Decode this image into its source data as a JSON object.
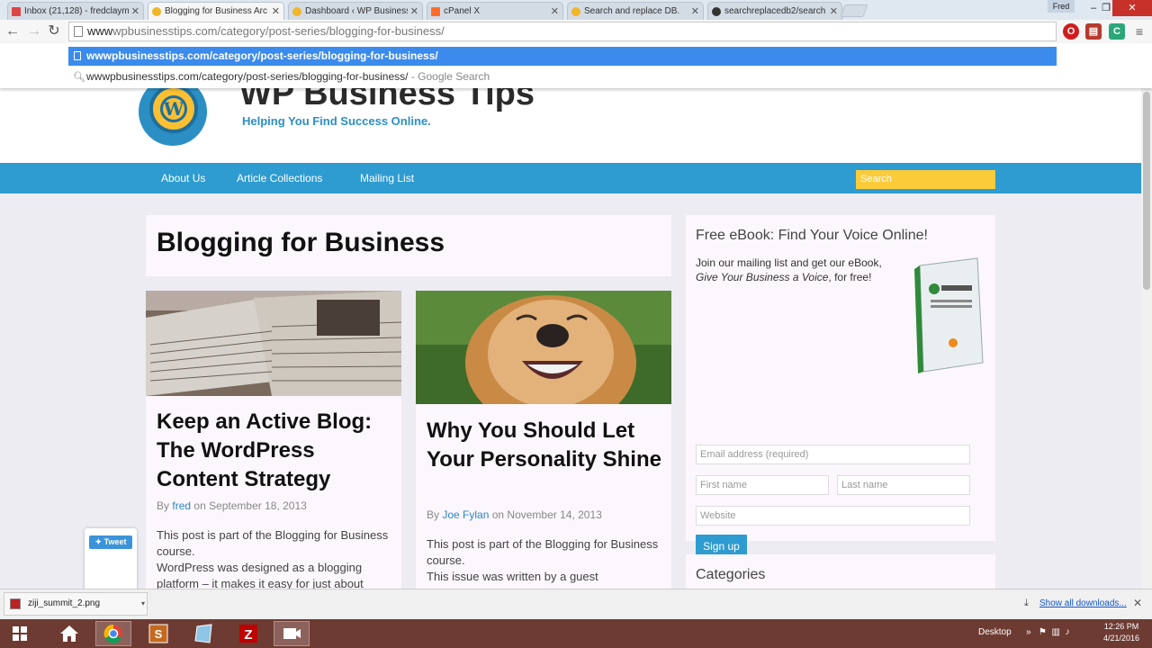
{
  "browser": {
    "tabs": [
      {
        "label": "Inbox (21,128) - fredclaym",
        "active": false,
        "favicon_color": "#d44"
      },
      {
        "label": "Blogging for Business Arc",
        "active": true,
        "favicon_color": "#f0b52b"
      },
      {
        "label": "Dashboard ‹ WP Business",
        "active": false,
        "favicon_color": "#f0b52b"
      },
      {
        "label": "cPanel X",
        "active": false,
        "favicon_color": "#ff6c2c"
      },
      {
        "label": "Search and replace DB.",
        "active": false,
        "favicon_color": "#f0b52b"
      },
      {
        "label": "searchreplacedb2/search",
        "active": false,
        "favicon_color": "#333333"
      }
    ],
    "user": "Fred",
    "address_typed": "www",
    "address_rest": "wpbusinesstips.com/category/post-series/blogging-for-business/",
    "suggestion_url": "wwwpbusinesstips.com/category/post-series/blogging-for-business/",
    "suggestion_search": "wwwpbusinesstips.com/category/post-series/blogging-for-business/",
    "suggestion_search_suffix": "- Google Search"
  },
  "site": {
    "title": "WP Business Tips",
    "tagline": "Helping You Find Success Online.",
    "nav": [
      "About Us",
      "Article Collections",
      "Mailing List"
    ],
    "search_placeholder": "Search"
  },
  "archive_title": "Blogging for Business",
  "posts": [
    {
      "title": "Keep an Active Blog: The WordPress Content Strategy",
      "by": "By",
      "author": "fred",
      "date": "on September 18, 2013",
      "excerpt_1": "This post is part of the Blogging for Business course.",
      "excerpt_2": "WordPress was designed as a blogging platform – it makes it easy for just about"
    },
    {
      "title": "Why You Should Let Your Personality Shine",
      "by": "By",
      "author": "Joe Fylan",
      "date": "on November 14, 2013",
      "excerpt_1": "This post is part of the Blogging for Business course.",
      "excerpt_2": "This issue was written by a guest"
    }
  ],
  "sidebar": {
    "ebook_title": "Free eBook: Find Your Voice Online!",
    "ebook_text": "Join our mailing list and get our eBook,",
    "ebook_book_name": "Give Your Business a Voice",
    "ebook_text_end": ", for free!",
    "email_placeholder": "Email address (required)",
    "first_placeholder": "First name",
    "last_placeholder": "Last name",
    "website_placeholder": "Website",
    "signup_label": "Sign up",
    "categories_title": "Categories"
  },
  "tweet_label": "Tweet",
  "downloads": {
    "file": "ziji_summit_2.png",
    "show_all": "Show all downloads..."
  },
  "taskbar": {
    "desktop_label": "Desktop",
    "time": "12:26 PM",
    "date": "4/21/2016"
  },
  "colors": {
    "nav_blue": "#2e9bd1",
    "search_yellow": "#fbcb3a",
    "link_blue": "#2e86c1",
    "suggestion_highlight": "#3b8bec",
    "taskbar": "#6e3b32"
  }
}
